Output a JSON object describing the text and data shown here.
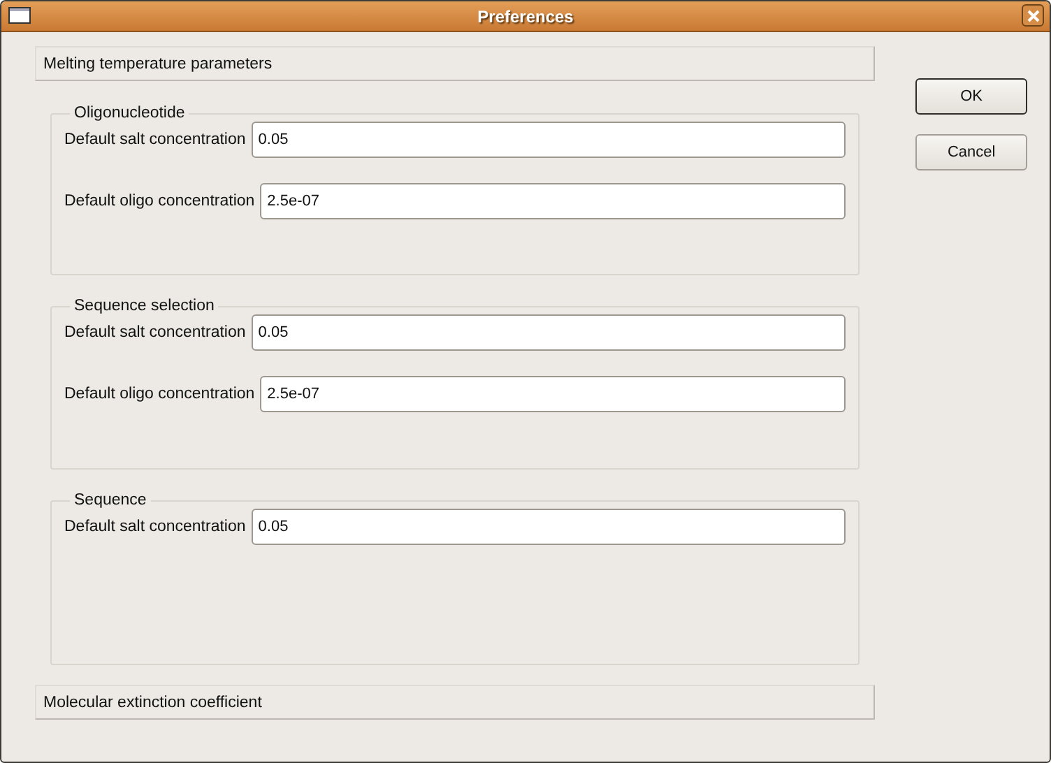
{
  "window": {
    "title": "Preferences"
  },
  "header": {
    "label": "Melting temperature parameters"
  },
  "groups": [
    {
      "title": "Oligonucleotide",
      "fields": [
        {
          "label": "Default salt concentration",
          "value": "0.05"
        },
        {
          "label": "Default oligo concentration",
          "value": "2.5e-07"
        }
      ]
    },
    {
      "title": "Sequence selection",
      "fields": [
        {
          "label": "Default salt concentration",
          "value": "0.05"
        },
        {
          "label": "Default oligo concentration",
          "value": "2.5e-07"
        }
      ]
    },
    {
      "title": "Sequence",
      "fields": [
        {
          "label": "Default salt concentration",
          "value": "0.05"
        }
      ]
    }
  ],
  "footer": {
    "label": "Molecular extinction coefficient"
  },
  "buttons": [
    {
      "label": "OK",
      "default": true
    },
    {
      "label": "Cancel",
      "default": false
    }
  ]
}
